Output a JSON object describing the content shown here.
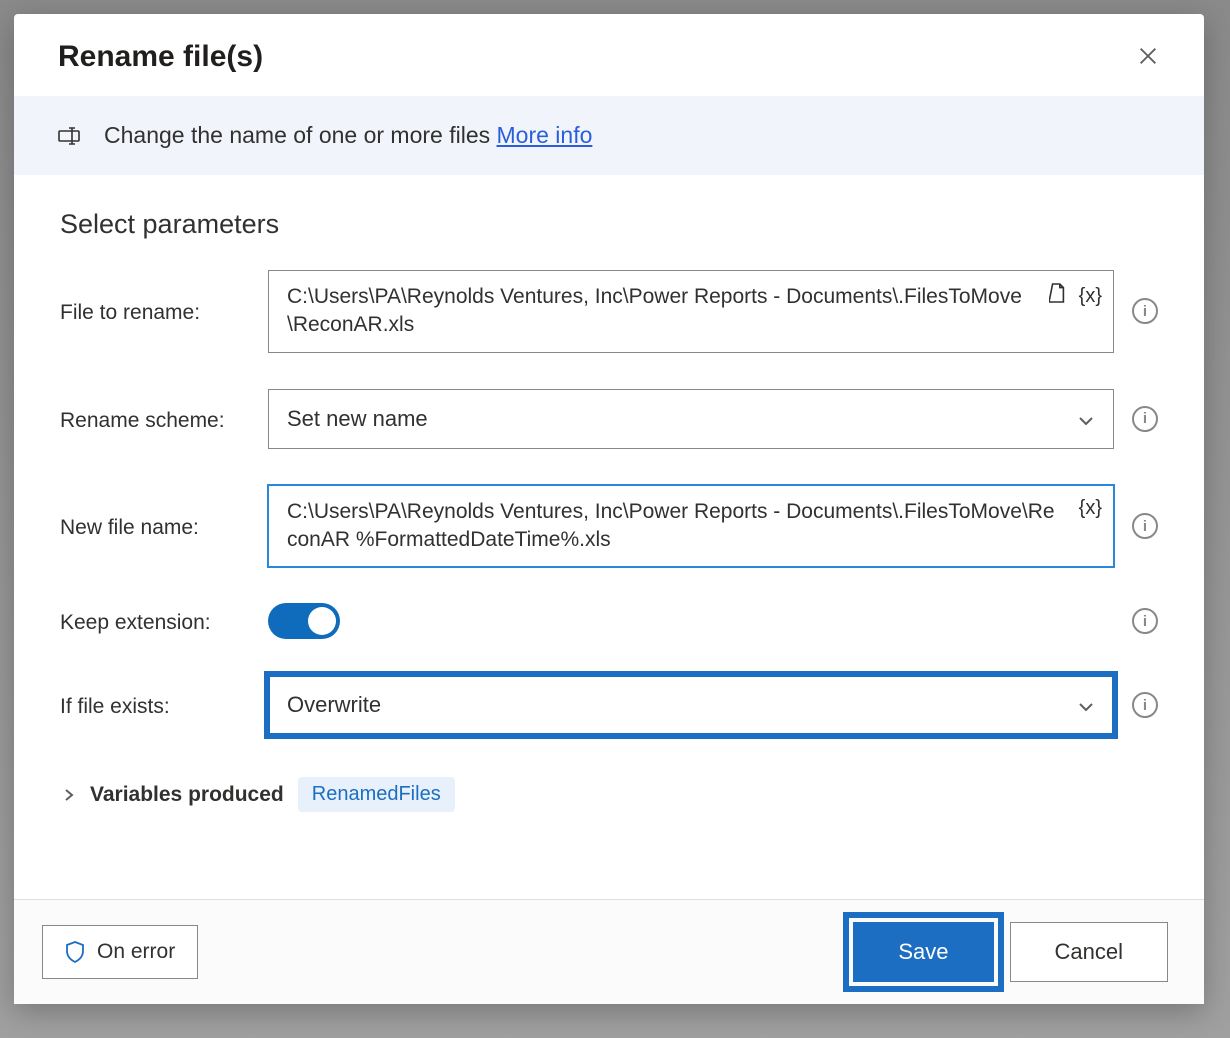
{
  "dialog": {
    "title": "Rename file(s)",
    "info_text": "Change the name of one or more files",
    "more_info": "More info",
    "section_title": "Select parameters"
  },
  "params": {
    "file_to_rename": {
      "label": "File to rename:",
      "value": "C:\\Users\\PA\\Reynolds Ventures, Inc\\Power Reports - Documents\\.FilesToMove\\ReconAR.xls"
    },
    "rename_scheme": {
      "label": "Rename scheme:",
      "value": "Set new name"
    },
    "new_file_name": {
      "label": "New file name:",
      "value": "C:\\Users\\PA\\Reynolds Ventures, Inc\\Power Reports - Documents\\.FilesToMove\\ReconAR %FormattedDateTime%.xls"
    },
    "keep_extension": {
      "label": "Keep extension:",
      "value": true
    },
    "if_file_exists": {
      "label": "If file exists:",
      "value": "Overwrite"
    }
  },
  "variables": {
    "label": "Variables produced",
    "chip": "RenamedFiles"
  },
  "footer": {
    "on_error": "On error",
    "save": "Save",
    "cancel": "Cancel"
  },
  "affordances": {
    "variable_token": "{x}"
  }
}
